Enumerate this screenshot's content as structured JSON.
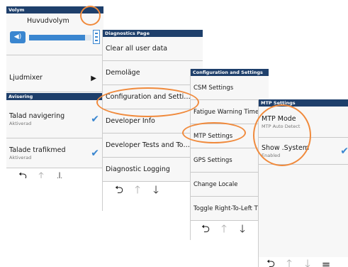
{
  "panel1": {
    "header": "Volym",
    "volume_title": "Huvudvolym",
    "volume_level": 0.9,
    "mixer_label": "Ljudmixer",
    "section_header": "Avisering",
    "items": [
      {
        "label": "Talad navigering",
        "sub": "Aktiverad"
      },
      {
        "label": "Talade trafikmed",
        "sub": "Aktiverad"
      }
    ]
  },
  "panel2": {
    "header": "Diagnostics Page",
    "items": [
      "Clear all user data",
      "Demoläge",
      "Configuration and Setti…",
      "Developer Info",
      "Developer Tests and To…",
      "Diagnostic Logging"
    ]
  },
  "panel3": {
    "header": "Configuration and Settings",
    "items": [
      "CSM Settings",
      "Fatigue Warning Time",
      "MTP Settings",
      "GPS Settings",
      "Change Locale",
      "Toggle Right-To-Left T"
    ]
  },
  "panel4": {
    "header": "MTP Settings",
    "items": [
      {
        "label": "MTP Mode",
        "sub": "MTP Auto Detect"
      },
      {
        "label": "Show .System",
        "sub": "Enabled"
      }
    ]
  },
  "colors": {
    "header": "#1e3f6b",
    "accent": "#3a86d0",
    "highlight": "#f08a3c"
  },
  "icons": [
    "back-arrow-icon",
    "up-arrow-icon",
    "down-arrow-icon",
    "speaker-icon",
    "chevron-right-icon",
    "checkmark-icon",
    "menu-icon"
  ]
}
